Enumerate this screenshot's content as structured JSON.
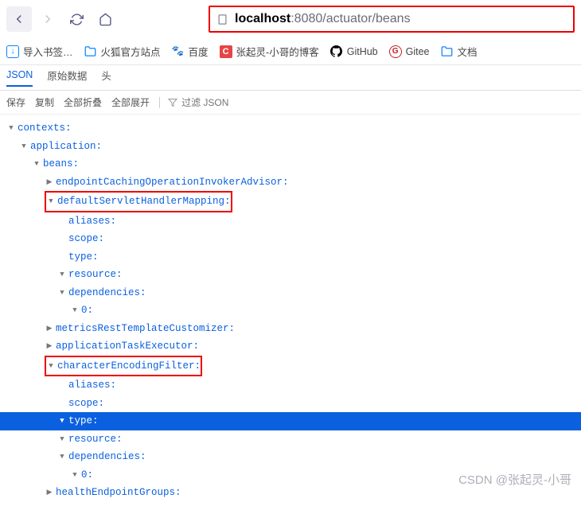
{
  "nav": {
    "url_host": "localhost",
    "url_rest": ":8080/actuator/beans"
  },
  "bookmarks": [
    {
      "label": "导入书签…",
      "icon": "import"
    },
    {
      "label": "火狐官方站点",
      "icon": "folder"
    },
    {
      "label": "百度",
      "icon": "paw"
    },
    {
      "label": "张起灵-小哥的博客",
      "icon": "c"
    },
    {
      "label": "GitHub",
      "icon": "gh"
    },
    {
      "label": "Gitee",
      "icon": "gitee"
    },
    {
      "label": "文档",
      "icon": "folder"
    }
  ],
  "tabs": [
    {
      "label": "JSON",
      "active": true
    },
    {
      "label": "原始数据",
      "active": false
    },
    {
      "label": "头",
      "active": false
    }
  ],
  "toolbar": {
    "save": "保存",
    "copy": "复制",
    "collapse_all": "全部折叠",
    "expand_all": "全部展开",
    "filter_placeholder": "过滤 JSON"
  },
  "tree": {
    "root": "contexts",
    "app": "application",
    "beans": "beans",
    "n1": "endpointCachingOperationInvokerAdvisor",
    "n2": "defaultServletHandlerMapping",
    "aliases": "aliases",
    "scope": "scope",
    "type": "type",
    "resource": "resource",
    "dependencies": "dependencies",
    "zero": "0",
    "n3": "metricsRestTemplateCustomizer",
    "n4": "applicationTaskExecutor",
    "n5": "characterEncodingFilter",
    "n6": "healthEndpointGroups"
  },
  "watermark": "CSDN @张起灵-小哥"
}
